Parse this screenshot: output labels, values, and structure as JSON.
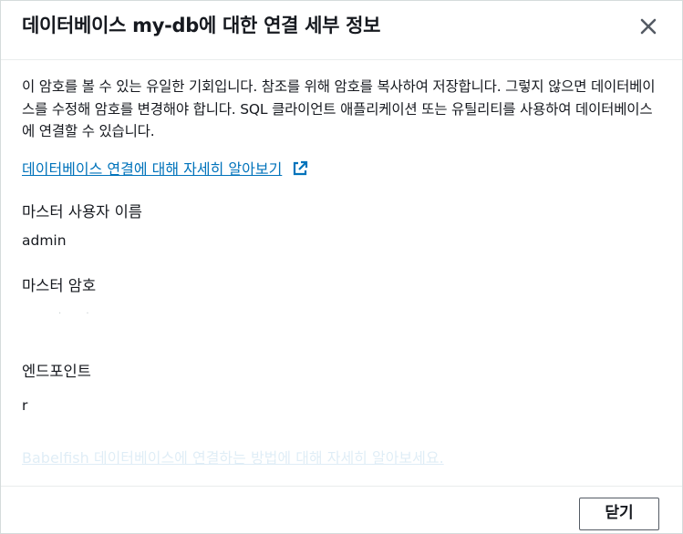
{
  "modal": {
    "title": "데이터베이스 my-db에 대한 연결 세부 정보",
    "close_icon": "close-icon"
  },
  "description": "이 암호를 볼 수 있는 유일한 기회입니다. 참조를 위해 암호를 복사하여 저장합니다. 그렇지 않으면 데이터베이스를 수정해 암호를 변경해야 합니다. SQL 클라이언트 애플리케이션 또는 유틸리티를 사용하여 데이터베이스에 연결할 수 있습니다.",
  "learn_more_link": {
    "label": "데이터베이스 연결에 대해 자세히 알아보기",
    "icon": "external-link-icon"
  },
  "fields": {
    "master_username": {
      "label": "마스터 사용자 이름",
      "value": "admin"
    },
    "master_password": {
      "label": "마스터 암호"
    },
    "endpoint": {
      "label": "엔드포인트",
      "value": "r"
    }
  },
  "faded_link": {
    "label": "Babelfish 데이터베이스에 연결하는 방법에 대해 자세히 알아보세요."
  },
  "footer": {
    "close_label": "닫기"
  },
  "colors": {
    "link": "#0073bb",
    "text": "#16191f",
    "border": "#545b64"
  }
}
